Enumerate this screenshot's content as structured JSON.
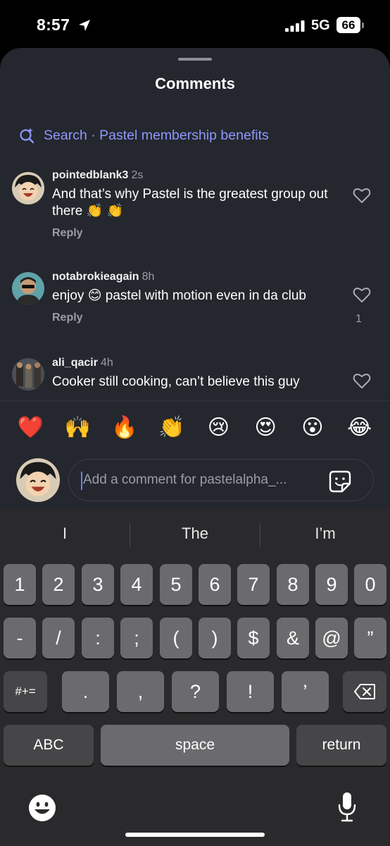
{
  "status_bar": {
    "time": "8:57",
    "network": "5G",
    "battery": "66",
    "location_icon": "location-arrow-icon",
    "signal_icon": "signal-bars-icon"
  },
  "sheet": {
    "title": "Comments",
    "search_label": "Search · Pastel membership benefits"
  },
  "comments": [
    {
      "username": "pointedblank3",
      "time": "2s",
      "text": "And that’s why Pastel is the greatest group out there 👏 👏",
      "reply_label": "Reply",
      "likes": ""
    },
    {
      "username": "notabrokieagain",
      "time": "8h",
      "text": "enjoy 😊 pastel with motion even in da club",
      "reply_label": "Reply",
      "likes": "1"
    },
    {
      "username": "ali_qacir",
      "time": "4h",
      "text": "Cooker still cooking, can’t believe this guy",
      "reply_label": "",
      "likes": ""
    }
  ],
  "quick_reactions": [
    "❤️",
    "🙌",
    "🔥",
    "👏",
    "😢",
    "😍",
    "😮",
    "😂"
  ],
  "composer": {
    "placeholder": "Add a comment for pastelalpha_..."
  },
  "keyboard": {
    "suggestions": [
      "I",
      "The",
      "I’m"
    ],
    "row_numbers": [
      "1",
      "2",
      "3",
      "4",
      "5",
      "6",
      "7",
      "8",
      "9",
      "0"
    ],
    "row_symbols": [
      "-",
      "/",
      ":",
      ";",
      "(",
      ")",
      "$",
      "&",
      "@",
      "”"
    ],
    "row_punct": [
      ".",
      ",",
      "?",
      "!",
      "’"
    ],
    "mode_key": "#+=",
    "abc_key": "ABC",
    "space_key": "space",
    "return_key": "return"
  },
  "colors": {
    "accent": "#8f98ff",
    "sheet_bg": "#24272d",
    "key_bg": "#6b6b6e",
    "keyboard_bg": "#2a2a2c"
  }
}
